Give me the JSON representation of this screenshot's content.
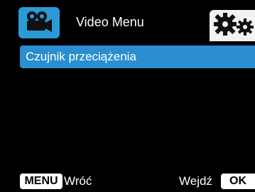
{
  "header": {
    "title": "Video Menu",
    "left_icon": "video-camera-icon",
    "right_icon": "gears-icon"
  },
  "menu": {
    "items": [
      {
        "label": "Czujnik przeciążenia",
        "selected": true
      }
    ]
  },
  "footer": {
    "menu_key": "MENU",
    "back_label": "Wróć",
    "enter_label": "Wejdź",
    "ok_key": "OK"
  },
  "colors": {
    "accent": "#2a8ed0",
    "badge": "#2c9ad7",
    "background": "#000000",
    "key_bg": "#ffffff"
  }
}
